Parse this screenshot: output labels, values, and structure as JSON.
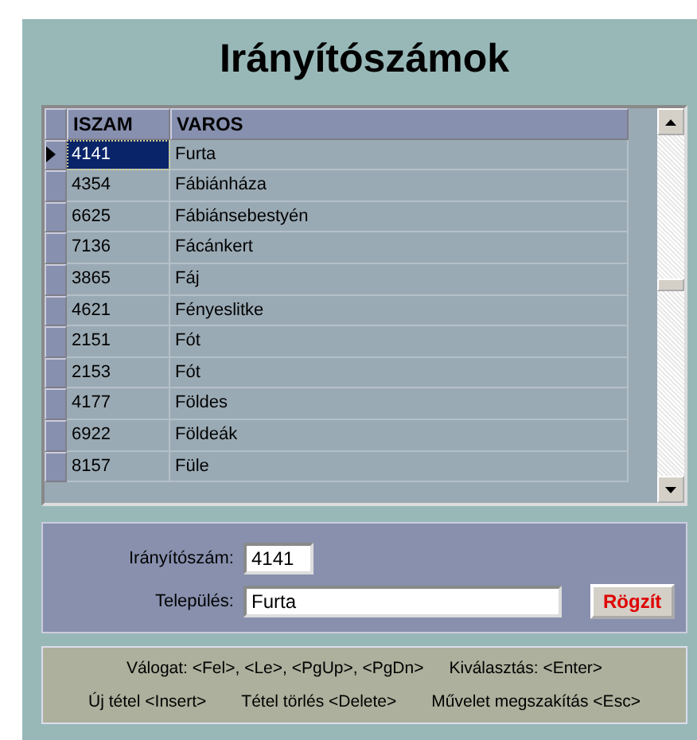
{
  "title": "Irányítószámok",
  "table": {
    "columns": [
      "ISZAM",
      "VAROS"
    ],
    "rows": [
      {
        "iszam": "4141",
        "varos": "Furta",
        "selected": true
      },
      {
        "iszam": "4354",
        "varos": "Fábiánháza",
        "selected": false
      },
      {
        "iszam": "6625",
        "varos": "Fábiánsebestyén",
        "selected": false
      },
      {
        "iszam": "7136",
        "varos": "Fácánkert",
        "selected": false
      },
      {
        "iszam": "3865",
        "varos": "Fáj",
        "selected": false
      },
      {
        "iszam": "4621",
        "varos": "Fényeslitke",
        "selected": false
      },
      {
        "iszam": "2151",
        "varos": "Fót",
        "selected": false
      },
      {
        "iszam": "2153",
        "varos": "Fót",
        "selected": false
      },
      {
        "iszam": "4177",
        "varos": "Földes",
        "selected": false
      },
      {
        "iszam": "6922",
        "varos": "Földeák",
        "selected": false
      },
      {
        "iszam": "8157",
        "varos": "Füle",
        "selected": false
      }
    ]
  },
  "form": {
    "fields": [
      {
        "label": "Irányítószám:",
        "value": "4141"
      },
      {
        "label": "Település:",
        "value": "Furta"
      }
    ],
    "button": "Rögzít"
  },
  "hotkeys": [
    [
      "Válogat: <Fel>, <Le>, <PgUp>, <PgDn>",
      "Kiválasztás: <Enter>"
    ],
    [
      "Új tétel <Insert>",
      "Tétel törlés <Delete>",
      "Művelet megszakítás <Esc>"
    ]
  ]
}
